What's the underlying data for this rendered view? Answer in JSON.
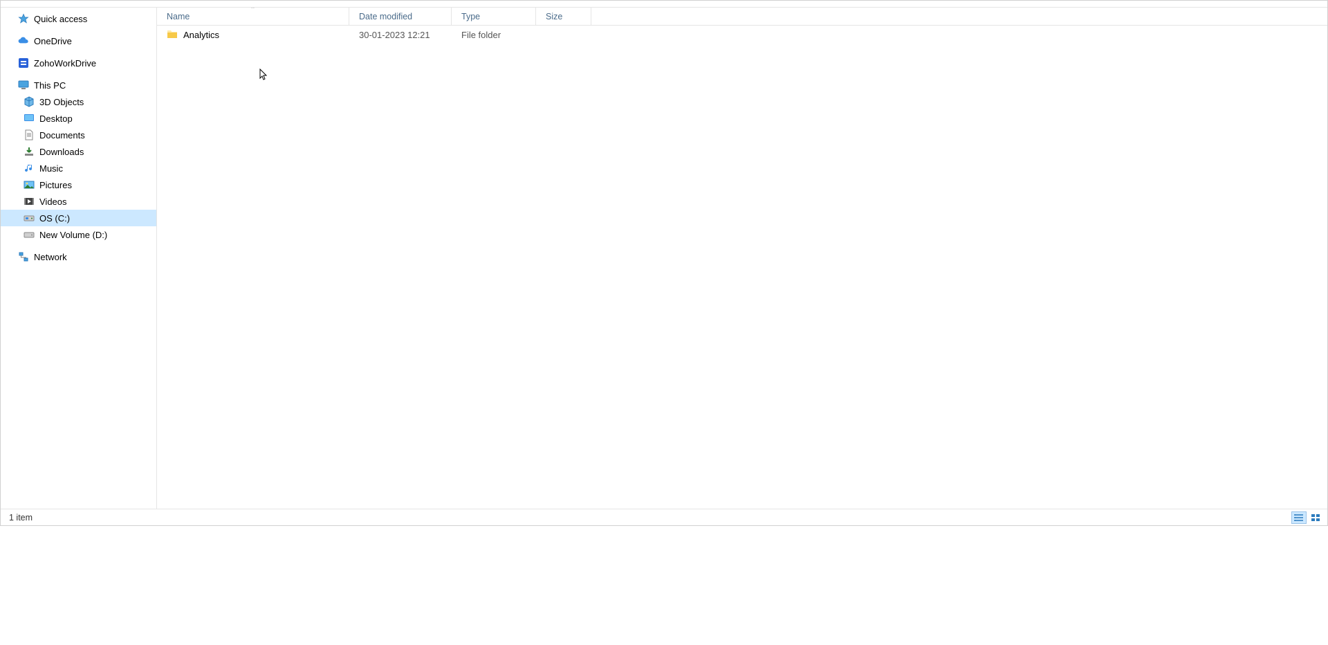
{
  "sidebar": {
    "quick_access": "Quick access",
    "onedrive": "OneDrive",
    "zoho": "ZohoWorkDrive",
    "this_pc": "This PC",
    "objects3d": "3D Objects",
    "desktop": "Desktop",
    "documents": "Documents",
    "downloads": "Downloads",
    "music": "Music",
    "pictures": "Pictures",
    "videos": "Videos",
    "osc": "OS (C:)",
    "newvol": "New Volume (D:)",
    "network": "Network"
  },
  "columns": {
    "name": "Name",
    "date": "Date modified",
    "type": "Type",
    "size": "Size"
  },
  "rows": [
    {
      "name": "Analytics",
      "date": "30-01-2023 12:21",
      "type": "File folder",
      "size": ""
    }
  ],
  "statusbar": {
    "count": "1 item"
  },
  "colors": {
    "accent": "#cce8ff",
    "link": "#4a6b8a",
    "folder1": "#ffe9a6",
    "folder2": "#f7c948"
  }
}
